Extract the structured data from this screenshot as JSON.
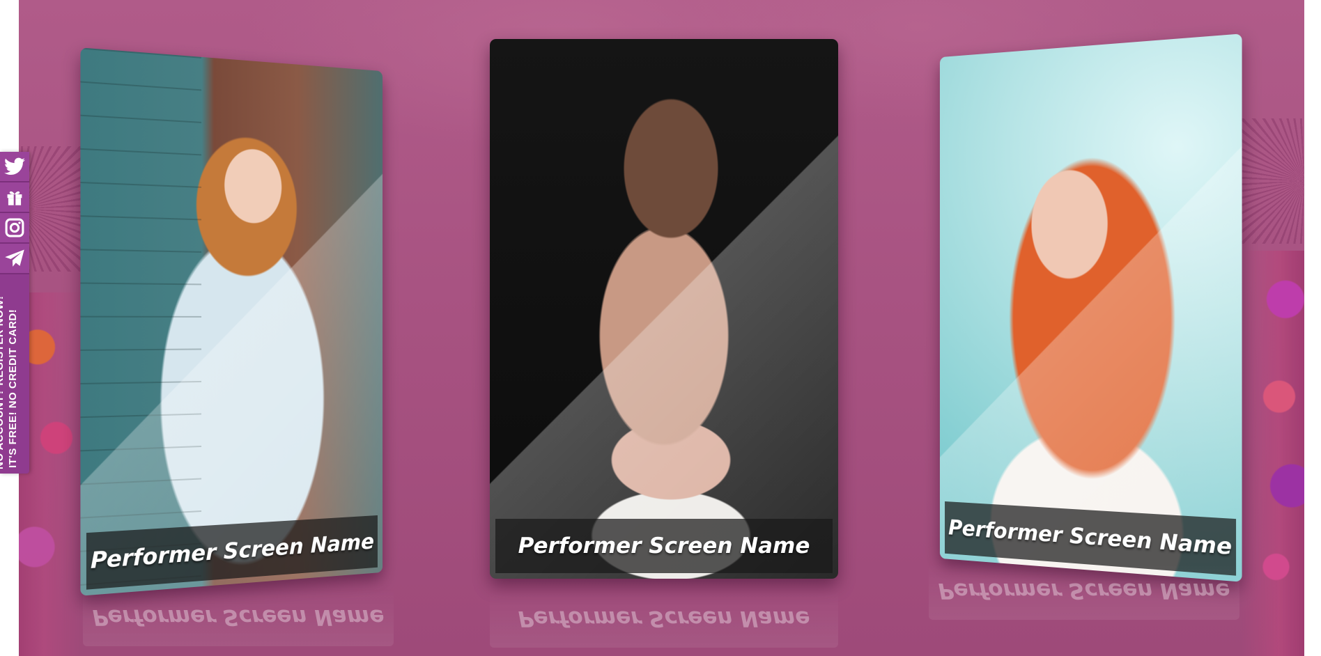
{
  "sidebar": {
    "icons": [
      "twitter-icon",
      "gift-icon",
      "instagram-icon",
      "telegram-icon"
    ],
    "promo_line1": "NO ACCOUNT? REGISTER NOW!",
    "promo_line2": "IT'S FREE! NO CREDIT CARD!"
  },
  "performers": [
    {
      "name": "Performer Screen Name"
    },
    {
      "name": "Performer Screen Name"
    },
    {
      "name": "Performer Screen Name"
    }
  ],
  "colors": {
    "background": "#a65180",
    "sidebar": "#8f3b8f",
    "name_bar": "#191919"
  }
}
